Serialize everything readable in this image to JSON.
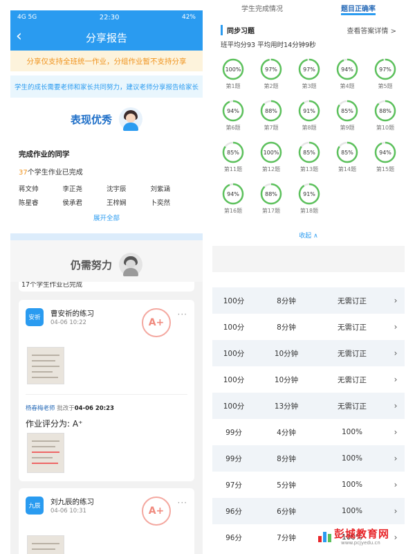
{
  "status": {
    "left": "4G 5G",
    "time": "22:30",
    "right": "42%"
  },
  "header": {
    "title": "分享报告"
  },
  "notice": {
    "warning": "分享仅支持全班统一作业，分组作业暂不支持分享",
    "tip": "学生的成长需要老师和家长共同努力，建议老师分享报告给家长"
  },
  "excellent": {
    "label": "表现优秀"
  },
  "completed": {
    "title": "完成作业的同学",
    "count": "37",
    "count_suffix": "个学生作业已完成",
    "students": [
      "蒋文帅",
      "李正尧",
      "沈宇辰",
      "刘紫涵",
      "陈星睿",
      "侯承君",
      "王梓娴",
      "卜奕然"
    ],
    "expand_label": "展开全部"
  },
  "needs_work": {
    "label": "仍需努力"
  },
  "list_stub": {
    "text": "个学生作业已完成",
    "num": "17"
  },
  "card1": {
    "avatar": "安祈",
    "name": "曹安祈的练习",
    "date": "04-06 10:22",
    "more": "···",
    "stamp": "A+",
    "teacher": "杨春梅老师",
    "corrected_label": "批改于",
    "corrected_time": "04-06 20:23",
    "score_label": "作业评分为:",
    "score": "A⁺"
  },
  "card2": {
    "avatar": "九辰",
    "name": "刘九辰的练习",
    "date": "04-06 10:31",
    "more": "···",
    "stamp": "A+"
  },
  "right_tabs": [
    "学生完成情况",
    "题目正确率"
  ],
  "practice": {
    "title": "同步习题",
    "detail_link": "查看答案详情 >",
    "summary": "班平均分93  平均用时14分钟9秒",
    "questions": [
      {
        "label": "第1题",
        "rate": 100
      },
      {
        "label": "第2题",
        "rate": 97
      },
      {
        "label": "第3题",
        "rate": 97
      },
      {
        "label": "第4题",
        "rate": 94
      },
      {
        "label": "第5题",
        "rate": 97
      },
      {
        "label": "第6题",
        "rate": 94
      },
      {
        "label": "第7题",
        "rate": 88
      },
      {
        "label": "第8题",
        "rate": 91
      },
      {
        "label": "第9题",
        "rate": 85
      },
      {
        "label": "第10题",
        "rate": 88
      },
      {
        "label": "第11题",
        "rate": 85
      },
      {
        "label": "第12题",
        "rate": 100
      },
      {
        "label": "第13题",
        "rate": 85
      },
      {
        "label": "第14题",
        "rate": 85
      },
      {
        "label": "第15题",
        "rate": 94
      },
      {
        "label": "第16题",
        "rate": 94
      },
      {
        "label": "第17题",
        "rate": 88
      },
      {
        "label": "第18题",
        "rate": 91
      }
    ],
    "collapse_label": "收起 ∧"
  },
  "results": [
    {
      "score": "100分",
      "time": "8分钟",
      "status": "无需订正"
    },
    {
      "score": "100分",
      "time": "8分钟",
      "status": "无需订正"
    },
    {
      "score": "100分",
      "time": "10分钟",
      "status": "无需订正"
    },
    {
      "score": "100分",
      "time": "10分钟",
      "status": "无需订正"
    },
    {
      "score": "100分",
      "time": "13分钟",
      "status": "无需订正"
    },
    {
      "score": "99分",
      "time": "4分钟",
      "status": "100%"
    },
    {
      "score": "99分",
      "time": "8分钟",
      "status": "100%"
    },
    {
      "score": "97分",
      "time": "5分钟",
      "status": "100%"
    },
    {
      "score": "96分",
      "time": "6分钟",
      "status": "100%"
    },
    {
      "score": "96分",
      "time": "7分钟",
      "status": "100%"
    }
  ],
  "watermark": {
    "name": "彭城教育网",
    "url": "www.pcjyedu.cn"
  },
  "colors": {
    "brand": "#2a9bf0",
    "ring": "#5cc15c",
    "warning": "#f0941f"
  }
}
